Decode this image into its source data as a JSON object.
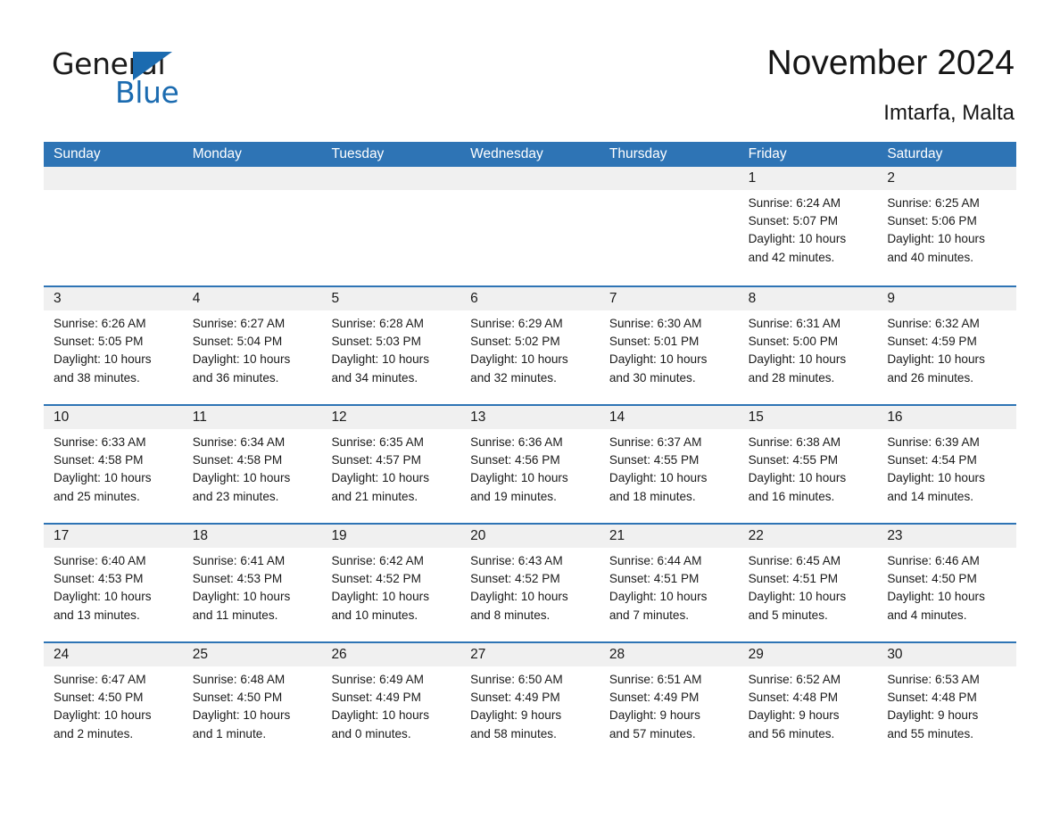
{
  "logo": {
    "word1": "General",
    "word2": "Blue",
    "triangle_color": "#1b6bb0"
  },
  "header": {
    "title": "November 2024",
    "location": "Imtarfa, Malta"
  },
  "theme": {
    "header_blue": "#2e74b5",
    "date_strip_gray": "#f0f0f0",
    "cell_white": "#ffffff",
    "text_dark": "#1a1a1a"
  },
  "calendar": {
    "weekdays": [
      "Sunday",
      "Monday",
      "Tuesday",
      "Wednesday",
      "Thursday",
      "Friday",
      "Saturday"
    ],
    "weeks": [
      [
        {
          "day": "",
          "lines": []
        },
        {
          "day": "",
          "lines": []
        },
        {
          "day": "",
          "lines": []
        },
        {
          "day": "",
          "lines": []
        },
        {
          "day": "",
          "lines": []
        },
        {
          "day": "1",
          "lines": [
            "Sunrise: 6:24 AM",
            "Sunset: 5:07 PM",
            "Daylight: 10 hours",
            "and 42 minutes."
          ]
        },
        {
          "day": "2",
          "lines": [
            "Sunrise: 6:25 AM",
            "Sunset: 5:06 PM",
            "Daylight: 10 hours",
            "and 40 minutes."
          ]
        }
      ],
      [
        {
          "day": "3",
          "lines": [
            "Sunrise: 6:26 AM",
            "Sunset: 5:05 PM",
            "Daylight: 10 hours",
            "and 38 minutes."
          ]
        },
        {
          "day": "4",
          "lines": [
            "Sunrise: 6:27 AM",
            "Sunset: 5:04 PM",
            "Daylight: 10 hours",
            "and 36 minutes."
          ]
        },
        {
          "day": "5",
          "lines": [
            "Sunrise: 6:28 AM",
            "Sunset: 5:03 PM",
            "Daylight: 10 hours",
            "and 34 minutes."
          ]
        },
        {
          "day": "6",
          "lines": [
            "Sunrise: 6:29 AM",
            "Sunset: 5:02 PM",
            "Daylight: 10 hours",
            "and 32 minutes."
          ]
        },
        {
          "day": "7",
          "lines": [
            "Sunrise: 6:30 AM",
            "Sunset: 5:01 PM",
            "Daylight: 10 hours",
            "and 30 minutes."
          ]
        },
        {
          "day": "8",
          "lines": [
            "Sunrise: 6:31 AM",
            "Sunset: 5:00 PM",
            "Daylight: 10 hours",
            "and 28 minutes."
          ]
        },
        {
          "day": "9",
          "lines": [
            "Sunrise: 6:32 AM",
            "Sunset: 4:59 PM",
            "Daylight: 10 hours",
            "and 26 minutes."
          ]
        }
      ],
      [
        {
          "day": "10",
          "lines": [
            "Sunrise: 6:33 AM",
            "Sunset: 4:58 PM",
            "Daylight: 10 hours",
            "and 25 minutes."
          ]
        },
        {
          "day": "11",
          "lines": [
            "Sunrise: 6:34 AM",
            "Sunset: 4:58 PM",
            "Daylight: 10 hours",
            "and 23 minutes."
          ]
        },
        {
          "day": "12",
          "lines": [
            "Sunrise: 6:35 AM",
            "Sunset: 4:57 PM",
            "Daylight: 10 hours",
            "and 21 minutes."
          ]
        },
        {
          "day": "13",
          "lines": [
            "Sunrise: 6:36 AM",
            "Sunset: 4:56 PM",
            "Daylight: 10 hours",
            "and 19 minutes."
          ]
        },
        {
          "day": "14",
          "lines": [
            "Sunrise: 6:37 AM",
            "Sunset: 4:55 PM",
            "Daylight: 10 hours",
            "and 18 minutes."
          ]
        },
        {
          "day": "15",
          "lines": [
            "Sunrise: 6:38 AM",
            "Sunset: 4:55 PM",
            "Daylight: 10 hours",
            "and 16 minutes."
          ]
        },
        {
          "day": "16",
          "lines": [
            "Sunrise: 6:39 AM",
            "Sunset: 4:54 PM",
            "Daylight: 10 hours",
            "and 14 minutes."
          ]
        }
      ],
      [
        {
          "day": "17",
          "lines": [
            "Sunrise: 6:40 AM",
            "Sunset: 4:53 PM",
            "Daylight: 10 hours",
            "and 13 minutes."
          ]
        },
        {
          "day": "18",
          "lines": [
            "Sunrise: 6:41 AM",
            "Sunset: 4:53 PM",
            "Daylight: 10 hours",
            "and 11 minutes."
          ]
        },
        {
          "day": "19",
          "lines": [
            "Sunrise: 6:42 AM",
            "Sunset: 4:52 PM",
            "Daylight: 10 hours",
            "and 10 minutes."
          ]
        },
        {
          "day": "20",
          "lines": [
            "Sunrise: 6:43 AM",
            "Sunset: 4:52 PM",
            "Daylight: 10 hours",
            "and 8 minutes."
          ]
        },
        {
          "day": "21",
          "lines": [
            "Sunrise: 6:44 AM",
            "Sunset: 4:51 PM",
            "Daylight: 10 hours",
            "and 7 minutes."
          ]
        },
        {
          "day": "22",
          "lines": [
            "Sunrise: 6:45 AM",
            "Sunset: 4:51 PM",
            "Daylight: 10 hours",
            "and 5 minutes."
          ]
        },
        {
          "day": "23",
          "lines": [
            "Sunrise: 6:46 AM",
            "Sunset: 4:50 PM",
            "Daylight: 10 hours",
            "and 4 minutes."
          ]
        }
      ],
      [
        {
          "day": "24",
          "lines": [
            "Sunrise: 6:47 AM",
            "Sunset: 4:50 PM",
            "Daylight: 10 hours",
            "and 2 minutes."
          ]
        },
        {
          "day": "25",
          "lines": [
            "Sunrise: 6:48 AM",
            "Sunset: 4:50 PM",
            "Daylight: 10 hours",
            "and 1 minute."
          ]
        },
        {
          "day": "26",
          "lines": [
            "Sunrise: 6:49 AM",
            "Sunset: 4:49 PM",
            "Daylight: 10 hours",
            "and 0 minutes."
          ]
        },
        {
          "day": "27",
          "lines": [
            "Sunrise: 6:50 AM",
            "Sunset: 4:49 PM",
            "Daylight: 9 hours",
            "and 58 minutes."
          ]
        },
        {
          "day": "28",
          "lines": [
            "Sunrise: 6:51 AM",
            "Sunset: 4:49 PM",
            "Daylight: 9 hours",
            "and 57 minutes."
          ]
        },
        {
          "day": "29",
          "lines": [
            "Sunrise: 6:52 AM",
            "Sunset: 4:48 PM",
            "Daylight: 9 hours",
            "and 56 minutes."
          ]
        },
        {
          "day": "30",
          "lines": [
            "Sunrise: 6:53 AM",
            "Sunset: 4:48 PM",
            "Daylight: 9 hours",
            "and 55 minutes."
          ]
        }
      ]
    ]
  }
}
